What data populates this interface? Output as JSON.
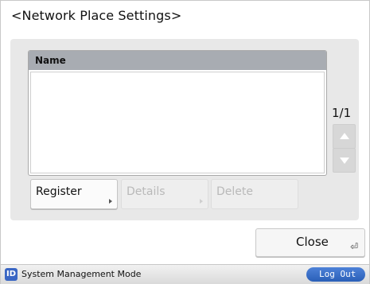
{
  "dialog": {
    "title": "<Network Place Settings>"
  },
  "list": {
    "column_header": "Name",
    "rows": [],
    "page_indicator": "1/1"
  },
  "actions": {
    "register_label": "Register",
    "details_label": "Details",
    "delete_label": "Delete"
  },
  "footer": {
    "close_label": "Close",
    "close_enter_glyph": "⏎"
  },
  "status_bar": {
    "id_icon_label": "ID",
    "mode_text": "System Management Mode",
    "logout_label": "Log Out"
  },
  "colors": {
    "accent": "#2f63bf",
    "panel": "#e8e8e8",
    "header": "#a8acb2"
  }
}
